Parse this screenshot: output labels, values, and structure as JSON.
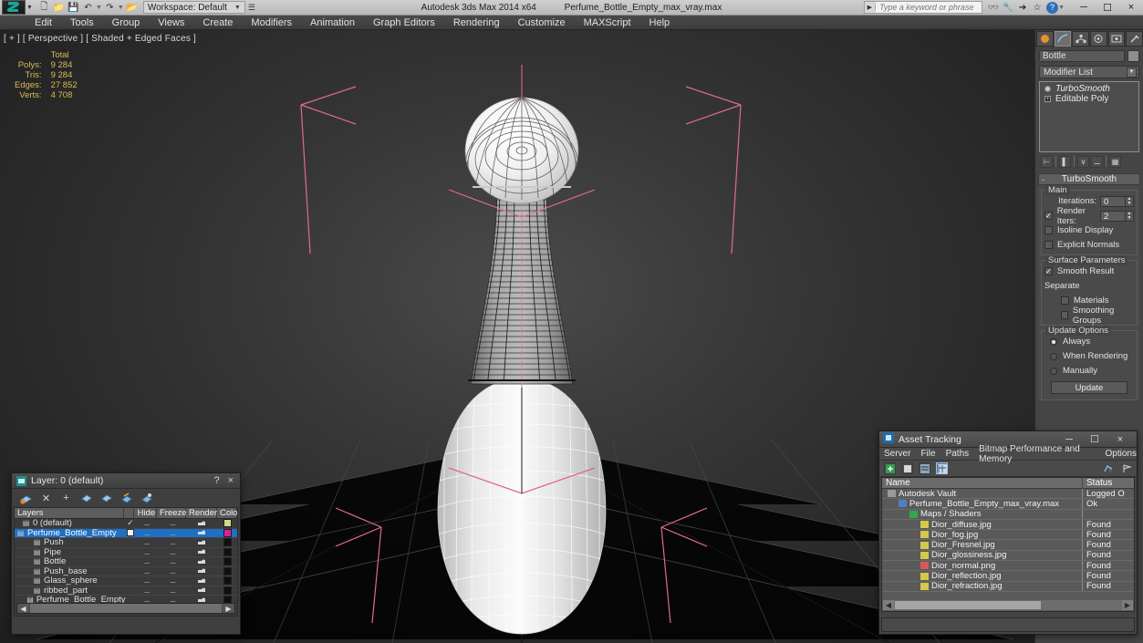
{
  "titlebar": {
    "workspace": "Workspace: Default",
    "app_title": "Autodesk 3ds Max  2014 x64",
    "file_title": "Perfume_Bottle_Empty_max_vray.max",
    "search_placeholder": "Type a keyword or phrase",
    "minimize": "─",
    "maximize": "☐",
    "close": "×"
  },
  "menubar": {
    "items": [
      "Edit",
      "Tools",
      "Group",
      "Views",
      "Create",
      "Modifiers",
      "Animation",
      "Graph Editors",
      "Rendering",
      "Customize",
      "MAXScript",
      "Help"
    ]
  },
  "viewport": {
    "label": "[ + ] [ Perspective ] [ Shaded + Edged Faces ]",
    "stats_header": "Total",
    "stats": [
      {
        "label": "Polys:",
        "value": "9 284"
      },
      {
        "label": "Tris:",
        "value": "9 284"
      },
      {
        "label": "Edges:",
        "value": "27 852"
      },
      {
        "label": "Verts:",
        "value": "4 708"
      }
    ]
  },
  "command_panel": {
    "object_name": "Bottle",
    "modifier_list_label": "Modifier List",
    "stack": [
      {
        "label": "TurboSmooth",
        "italic": true
      },
      {
        "label": "Editable Poly",
        "italic": false
      }
    ],
    "rollout": {
      "title": "TurboSmooth",
      "main_group": "Main",
      "iterations_label": "Iterations:",
      "iterations_value": "0",
      "render_iters_label": "Render Iters:",
      "render_iters_value": "2",
      "isoline_display": "Isoline Display",
      "explicit_normals": "Explicit Normals",
      "surface_group": "Surface Parameters",
      "smooth_result": "Smooth Result",
      "separate_label": "Separate",
      "materials": "Materials",
      "smoothing_groups": "Smoothing Groups",
      "update_group": "Update Options",
      "always": "Always",
      "when_rendering": "When Rendering",
      "manually": "Manually",
      "update_button": "Update"
    }
  },
  "layer_window": {
    "title": "Layer: 0 (default)",
    "help": "?",
    "close": "×",
    "columns": [
      "Layers",
      "Hide",
      "Freeze",
      "Render",
      "Color"
    ],
    "rows": [
      {
        "name": "0 (default)",
        "indent": 8,
        "selected": false,
        "check": true,
        "box": false,
        "color": "#c8e08a"
      },
      {
        "name": "Perfume_Bottle_Empty",
        "indent": 2,
        "selected": true,
        "check": false,
        "box": true,
        "color": "#e01ea0"
      },
      {
        "name": "Push",
        "indent": 20,
        "selected": false,
        "check": false,
        "box": false,
        "color": "#101010"
      },
      {
        "name": "Pipe",
        "indent": 20,
        "selected": false,
        "check": false,
        "box": false,
        "color": "#101010"
      },
      {
        "name": "Bottle",
        "indent": 20,
        "selected": false,
        "check": false,
        "box": false,
        "color": "#101010"
      },
      {
        "name": "Push_base",
        "indent": 20,
        "selected": false,
        "check": false,
        "box": false,
        "color": "#101010"
      },
      {
        "name": "Glass_sphere",
        "indent": 20,
        "selected": false,
        "check": false,
        "box": false,
        "color": "#101010"
      },
      {
        "name": "ribbed_part",
        "indent": 20,
        "selected": false,
        "check": false,
        "box": false,
        "color": "#101010"
      },
      {
        "name": "Perfume_Bottle_Empty",
        "indent": 20,
        "selected": false,
        "check": false,
        "box": false,
        "color": "#101010"
      }
    ]
  },
  "asset_tracking": {
    "title": "Asset Tracking",
    "minimize": "─",
    "maximize": "☐",
    "close": "×",
    "menu": [
      "Server",
      "File",
      "Paths",
      "Bitmap Performance and Memory",
      "Options"
    ],
    "columns": {
      "name": "Name",
      "status": "Status"
    },
    "rows": [
      {
        "name": "Autodesk Vault",
        "status": "Logged O",
        "indent": 6,
        "icon": "#9a9a9a"
      },
      {
        "name": "Perfume_Bottle_Empty_max_vray.max",
        "status": "Ok",
        "indent": 18,
        "icon": "#4e7fc4"
      },
      {
        "name": "Maps / Shaders",
        "status": "",
        "indent": 30,
        "icon": "#2fa84f"
      },
      {
        "name": "Dior_diffuse.jpg",
        "status": "Found",
        "indent": 42,
        "icon": "#d6c84a"
      },
      {
        "name": "Dior_fog.jpg",
        "status": "Found",
        "indent": 42,
        "icon": "#d6c84a"
      },
      {
        "name": "Dior_Fresnel.jpg",
        "status": "Found",
        "indent": 42,
        "icon": "#d6c84a"
      },
      {
        "name": "Dior_glossiness.jpg",
        "status": "Found",
        "indent": 42,
        "icon": "#d6c84a"
      },
      {
        "name": "Dior_normal.png",
        "status": "Found",
        "indent": 42,
        "icon": "#d65a5a"
      },
      {
        "name": "Dior_reflection.jpg",
        "status": "Found",
        "indent": 42,
        "icon": "#d6c84a"
      },
      {
        "name": "Dior_refraction.jpg",
        "status": "Found",
        "indent": 42,
        "icon": "#d6c84a"
      }
    ]
  }
}
